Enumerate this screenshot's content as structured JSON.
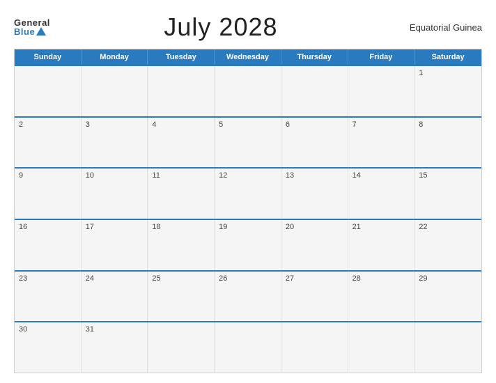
{
  "header": {
    "logo_general": "General",
    "logo_blue": "Blue",
    "title": "July 2028",
    "country": "Equatorial Guinea"
  },
  "days": [
    "Sunday",
    "Monday",
    "Tuesday",
    "Wednesday",
    "Thursday",
    "Friday",
    "Saturday"
  ],
  "weeks": [
    [
      {
        "num": "",
        "empty": true
      },
      {
        "num": "",
        "empty": true
      },
      {
        "num": "",
        "empty": true
      },
      {
        "num": "",
        "empty": true
      },
      {
        "num": "",
        "empty": true
      },
      {
        "num": "",
        "empty": true
      },
      {
        "num": "1",
        "empty": false
      }
    ],
    [
      {
        "num": "2",
        "empty": false
      },
      {
        "num": "3",
        "empty": false
      },
      {
        "num": "4",
        "empty": false
      },
      {
        "num": "5",
        "empty": false
      },
      {
        "num": "6",
        "empty": false
      },
      {
        "num": "7",
        "empty": false
      },
      {
        "num": "8",
        "empty": false
      }
    ],
    [
      {
        "num": "9",
        "empty": false
      },
      {
        "num": "10",
        "empty": false
      },
      {
        "num": "11",
        "empty": false
      },
      {
        "num": "12",
        "empty": false
      },
      {
        "num": "13",
        "empty": false
      },
      {
        "num": "14",
        "empty": false
      },
      {
        "num": "15",
        "empty": false
      }
    ],
    [
      {
        "num": "16",
        "empty": false
      },
      {
        "num": "17",
        "empty": false
      },
      {
        "num": "18",
        "empty": false
      },
      {
        "num": "19",
        "empty": false
      },
      {
        "num": "20",
        "empty": false
      },
      {
        "num": "21",
        "empty": false
      },
      {
        "num": "22",
        "empty": false
      }
    ],
    [
      {
        "num": "23",
        "empty": false
      },
      {
        "num": "24",
        "empty": false
      },
      {
        "num": "25",
        "empty": false
      },
      {
        "num": "26",
        "empty": false
      },
      {
        "num": "27",
        "empty": false
      },
      {
        "num": "28",
        "empty": false
      },
      {
        "num": "29",
        "empty": false
      }
    ],
    [
      {
        "num": "30",
        "empty": false
      },
      {
        "num": "31",
        "empty": false
      },
      {
        "num": "",
        "empty": true
      },
      {
        "num": "",
        "empty": true
      },
      {
        "num": "",
        "empty": true
      },
      {
        "num": "",
        "empty": true
      },
      {
        "num": "",
        "empty": true
      }
    ]
  ]
}
